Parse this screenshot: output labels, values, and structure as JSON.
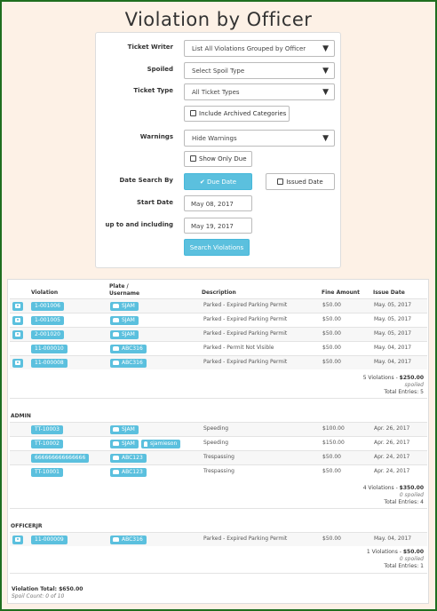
{
  "page": {
    "title": "Violation by Officer"
  },
  "filters": {
    "ticket_writer": {
      "label": "Ticket Writer",
      "value": "List All Violations Grouped by Officer"
    },
    "spoiled": {
      "label": "Spoiled",
      "value": "Select Spoil Type"
    },
    "ticket_type": {
      "label": "Ticket Type",
      "value": "All Ticket Types"
    },
    "include_archived": {
      "label": "Include Archived Categories",
      "checked": false
    },
    "warnings": {
      "label": "Warnings",
      "value": "Hide Warnings"
    },
    "show_only_due": {
      "label": "Show Only Due",
      "checked": false
    },
    "date_search_by": {
      "label": "Date Search By",
      "due": "Due Date",
      "issued": "Issued Date",
      "selected": "due"
    },
    "start_date": {
      "label": "Start Date",
      "value": "May 08, 2017"
    },
    "end_date": {
      "label": "up to and including",
      "value": "May 19, 2017"
    },
    "search_button": "Search Violations"
  },
  "table": {
    "headers": {
      "violation": "Violation",
      "plate": "Plate /",
      "username": "Username",
      "description": "Description",
      "fine": "Fine Amount",
      "issue_date": "Issue Date"
    },
    "groups": [
      {
        "name": "",
        "rows": [
          {
            "camera": true,
            "violation": "1-001006",
            "plate": "SJAM",
            "user": "",
            "description": "Parked - Expired Parking Permit",
            "fine": "$50.00",
            "date": "May. 05, 2017"
          },
          {
            "camera": true,
            "violation": "1-001005",
            "plate": "SJAM",
            "user": "",
            "description": "Parked - Expired Parking Permit",
            "fine": "$50.00",
            "date": "May. 05, 2017"
          },
          {
            "camera": true,
            "violation": "2-001020",
            "plate": "SJAM",
            "user": "",
            "description": "Parked - Expired Parking Permit",
            "fine": "$50.00",
            "date": "May. 05, 2017"
          },
          {
            "camera": false,
            "violation": "11-000010",
            "plate": "ABC316",
            "user": "",
            "description": "Parked - Permit Not Visible",
            "fine": "$50.00",
            "date": "May. 04, 2017"
          },
          {
            "camera": true,
            "violation": "11-000008",
            "plate": "ABC316",
            "user": "",
            "description": "Parked - Expired Parking Permit",
            "fine": "$50.00",
            "date": "May. 04, 2017"
          }
        ],
        "summary": {
          "count": "5 Violations - ",
          "amount": "$250.00",
          "spoiled": "spoiled",
          "entries": "Total Entries: 5"
        }
      },
      {
        "name": "ADMIN",
        "rows": [
          {
            "camera": false,
            "violation": "TT-10003",
            "plate": "SJAM",
            "user": "",
            "description": "Speeding",
            "fine": "$100.00",
            "date": "Apr. 26, 2017"
          },
          {
            "camera": false,
            "violation": "TT-10002",
            "plate": "SJAM",
            "user": "sjamieson",
            "description": "Speeding",
            "fine": "$150.00",
            "date": "Apr. 26, 2017"
          },
          {
            "camera": false,
            "violation": "666666666666666",
            "plate": "ABC123",
            "user": "",
            "description": "Trespassing",
            "fine": "$50.00",
            "date": "Apr. 24, 2017"
          },
          {
            "camera": false,
            "violation": "TT-10001",
            "plate": "ABC123",
            "user": "",
            "description": "Trespassing",
            "fine": "$50.00",
            "date": "Apr. 24, 2017"
          }
        ],
        "summary": {
          "count": "4 Violations - ",
          "amount": "$350.00",
          "spoiled": "0 spoiled",
          "entries": "Total Entries: 4"
        }
      },
      {
        "name": "OFFICERJR",
        "rows": [
          {
            "camera": true,
            "violation": "11-000009",
            "plate": "ABC316",
            "user": "",
            "description": "Parked - Expired Parking Permit",
            "fine": "$50.00",
            "date": "May. 04, 2017"
          }
        ],
        "summary": {
          "count": "1 Violations - ",
          "amount": "$50.00",
          "spoiled": "0 spoiled",
          "entries": "Total Entries: 1"
        }
      }
    ],
    "total": {
      "label": "Violation Total: ",
      "amount": "$650.00",
      "spoil_count": "Spoil Count: 0 of 10"
    }
  }
}
